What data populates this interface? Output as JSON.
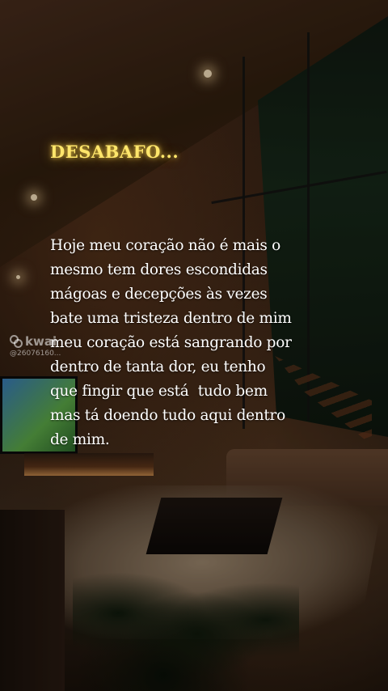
{
  "title": "DESABAFO...",
  "body_lines": [
    "Hoje meu coração não é mais o",
    "mesmo tem dores escondidas",
    "mágoas e decepções às vezes",
    "bate uma tristeza dentro de mim",
    "meu coração está sangrando por",
    "dentro de tanta dor, eu tenho",
    "que fingir que está  tudo bem",
    "mas tá doendo tudo aqui dentro",
    "de mim."
  ],
  "watermark": {
    "brand": "kwai",
    "user_id": "@26076160..."
  },
  "colors": {
    "title": "#ffe66b",
    "body_text": "#ffffff"
  }
}
